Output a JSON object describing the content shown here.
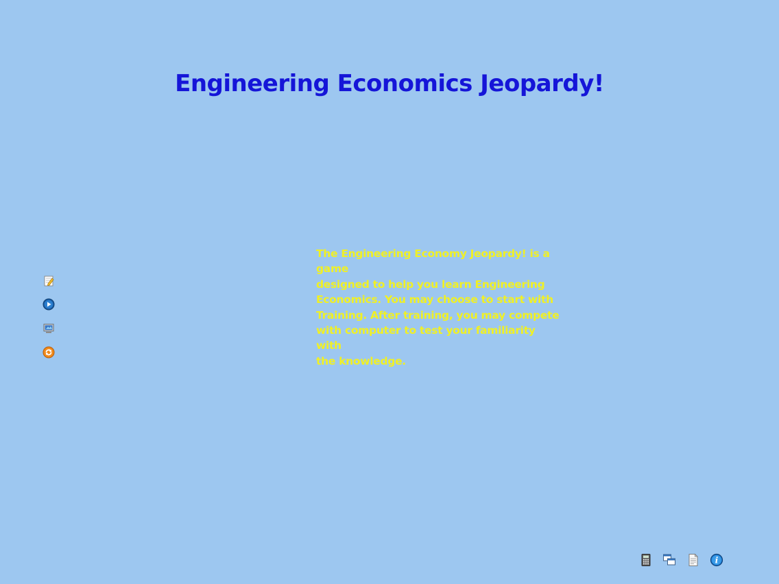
{
  "colors": {
    "background": "#9dc7f0",
    "title": "#1515d8",
    "intro_text": "#f0f025"
  },
  "header": {
    "title": "Engineering Economics Jeopardy!"
  },
  "intro": {
    "lines": [
      "The Engineering Economy Jeopardy! is a game",
      "designed to help you learn Engineering",
      "Economics. You may choose to start with",
      "Training. After training, you may compete",
      "with computer to test your familiarity with",
      "the knowledge."
    ]
  },
  "side_menu": {
    "items": [
      {
        "icon": "notepad-pencil-icon"
      },
      {
        "icon": "play-icon"
      },
      {
        "icon": "computer-screen-icon"
      },
      {
        "icon": "refresh-icon"
      }
    ]
  },
  "toolbar": {
    "items": [
      {
        "icon": "calculator-icon"
      },
      {
        "icon": "windows-icon"
      },
      {
        "icon": "document-icon"
      },
      {
        "icon": "info-icon"
      }
    ]
  }
}
